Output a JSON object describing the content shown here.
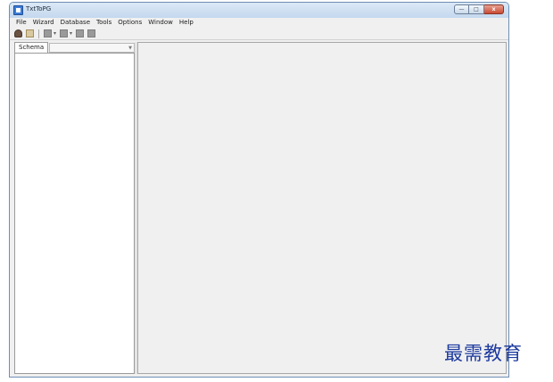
{
  "window": {
    "title": "TxtToPG",
    "controls": {
      "minimize": "—",
      "maximize": "□",
      "close": "x"
    }
  },
  "menu": {
    "items": [
      {
        "label": "File"
      },
      {
        "label": "Wizard"
      },
      {
        "label": "Database"
      },
      {
        "label": "Tools"
      },
      {
        "label": "Options"
      },
      {
        "label": "Window"
      },
      {
        "label": "Help"
      }
    ]
  },
  "toolbar": {
    "buttons": [
      {
        "icon": "connect-user-icon"
      },
      {
        "icon": "document-icon"
      },
      {
        "icon": "grid-icon"
      },
      {
        "icon": "table-icon"
      },
      {
        "icon": "query-icon"
      },
      {
        "icon": "export-icon"
      }
    ]
  },
  "left_panel": {
    "tab_label": "Schema",
    "combo_value": ""
  },
  "watermark": {
    "text": "最需教育"
  },
  "colors": {
    "titlebar": "#c8dbef",
    "workspace": "#f0f0f0",
    "watermark": "#1d3a9e"
  }
}
